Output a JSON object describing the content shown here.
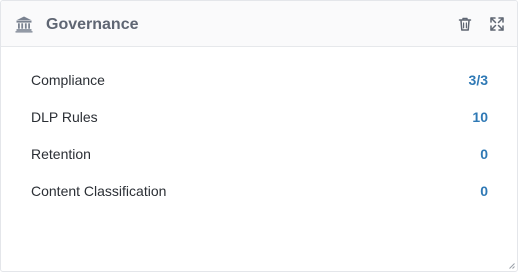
{
  "widget": {
    "title": "Governance",
    "title_icon": "bank-icon",
    "actions": [
      {
        "name": "delete",
        "icon": "trash-icon"
      },
      {
        "name": "expand",
        "icon": "expand-arrows-icon"
      }
    ]
  },
  "rows": [
    {
      "label": "Compliance",
      "value": "3/3"
    },
    {
      "label": "DLP Rules",
      "value": "10"
    },
    {
      "label": "Retention",
      "value": "0"
    },
    {
      "label": "Content Classification",
      "value": "0"
    }
  ],
  "colors": {
    "title": "#5f6673",
    "label": "#2b2f35",
    "value_link": "#2f79b5",
    "header_bg": "#fafafb",
    "border": "#e4e6ea"
  }
}
